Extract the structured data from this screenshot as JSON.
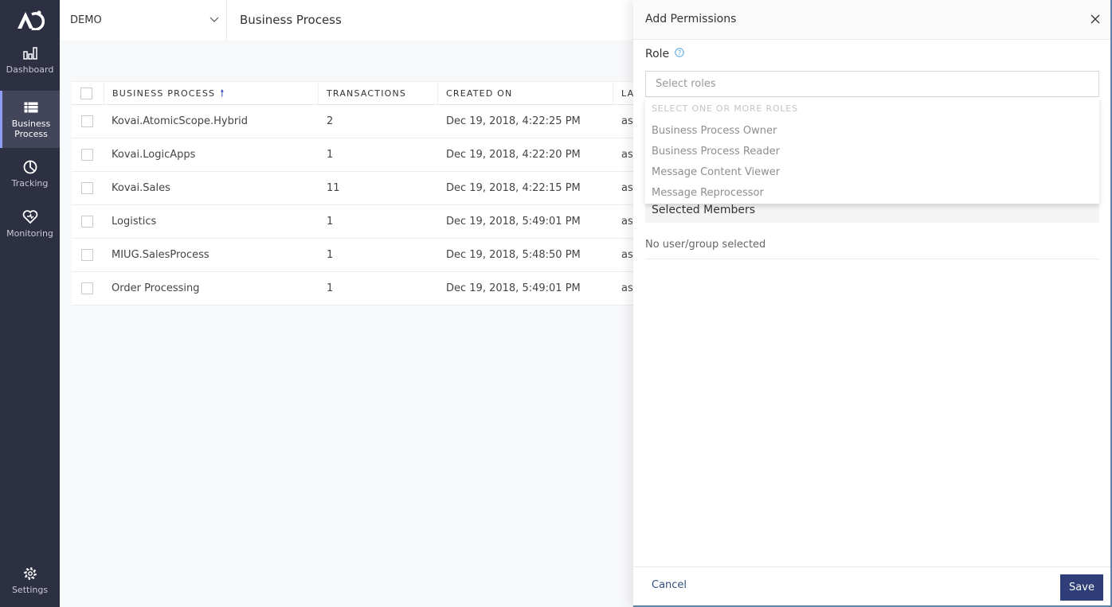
{
  "sidebar": {
    "items": [
      {
        "label": "Dashboard",
        "icon": "bar-chart-icon"
      },
      {
        "label": "Business Process",
        "icon": "table-list-icon",
        "active": true
      },
      {
        "label": "Tracking",
        "icon": "pie-chart-icon"
      },
      {
        "label": "Monitoring",
        "icon": "heart-pulse-icon"
      },
      {
        "label": "Settings",
        "icon": "gear-icon"
      }
    ]
  },
  "topbar": {
    "environment": "DEMO",
    "page_title": "Business Process"
  },
  "table": {
    "columns": [
      "BUSINESS PROCESS",
      "TRANSACTIONS",
      "CREATED ON",
      "LA"
    ],
    "sort_column": "BUSINESS PROCESS",
    "sort_direction": "ascending",
    "rows": [
      {
        "name": "Kovai.AtomicScope.Hybrid",
        "transactions": "2",
        "created_on": "Dec 19, 2018, 4:22:25 PM",
        "last": "as"
      },
      {
        "name": "Kovai.LogicApps",
        "transactions": "1",
        "created_on": "Dec 19, 2018, 4:22:20 PM",
        "last": "as"
      },
      {
        "name": "Kovai.Sales",
        "transactions": "11",
        "created_on": "Dec 19, 2018, 4:22:15 PM",
        "last": "as"
      },
      {
        "name": "Logistics",
        "transactions": "1",
        "created_on": "Dec 19, 2018, 5:49:01 PM",
        "last": "as"
      },
      {
        "name": "MIUG.SalesProcess",
        "transactions": "1",
        "created_on": "Dec 19, 2018, 5:48:50 PM",
        "last": "as"
      },
      {
        "name": "Order Processing",
        "transactions": "1",
        "created_on": "Dec 19, 2018, 5:49:01 PM",
        "last": "as"
      }
    ]
  },
  "panel": {
    "title": "Add Permissions",
    "role_label": "Role",
    "role_placeholder": "Select roles",
    "dropdown": {
      "header": "SELECT ONE OR MORE ROLES",
      "options": [
        "Business Process Owner",
        "Business Process Reader",
        "Message Content Viewer",
        "Message Reprocessor"
      ]
    },
    "selected_members_label": "Selected Members",
    "empty_selection": "No user/group selected",
    "cancel_label": "Cancel",
    "save_label": "Save"
  },
  "colors": {
    "sidebar_bg": "#2d2f42",
    "accent": "#2f3d78",
    "help_icon": "#4aa3df",
    "sort_arrow": "#2f46b8"
  }
}
